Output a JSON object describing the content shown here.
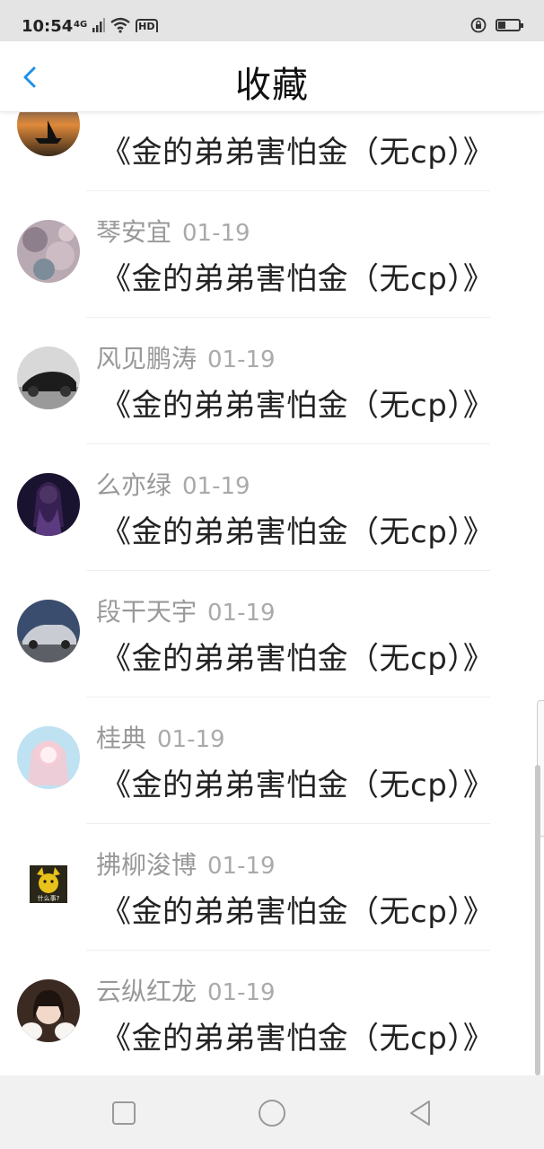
{
  "status_bar": {
    "time": "10:54",
    "network_label": "4G",
    "hd_label": "HD"
  },
  "header": {
    "title": "收藏",
    "back_icon": "chevron-left-icon"
  },
  "items": [
    {
      "user": "",
      "date": "",
      "title": "《金的弟弟害怕金（无cp）》"
    },
    {
      "user": "琴安宜",
      "date": "01-19",
      "title": "《金的弟弟害怕金（无cp）》"
    },
    {
      "user": "风见鹏涛",
      "date": "01-19",
      "title": "《金的弟弟害怕金（无cp）》"
    },
    {
      "user": "么亦绿",
      "date": "01-19",
      "title": "《金的弟弟害怕金（无cp）》"
    },
    {
      "user": "段干天宇",
      "date": "01-19",
      "title": "《金的弟弟害怕金（无cp）》"
    },
    {
      "user": "桂典",
      "date": "01-19",
      "title": "《金的弟弟害怕金（无cp）》"
    },
    {
      "user": "拂柳浚博",
      "date": "01-19",
      "title": "《金的弟弟害怕金（无cp）》",
      "avatar_caption": "什么事?"
    },
    {
      "user": "云纵红龙",
      "date": "01-19",
      "title": "《金的弟弟害怕金（无cp）》"
    }
  ],
  "nav_bar": {
    "icons": [
      "square-icon",
      "circle-home-icon",
      "triangle-back-icon"
    ]
  },
  "colors": {
    "accent": "#1e90e8",
    "title_text": "#222222",
    "meta_text": "#999999",
    "status_bar_bg": "#e4e4e4"
  }
}
